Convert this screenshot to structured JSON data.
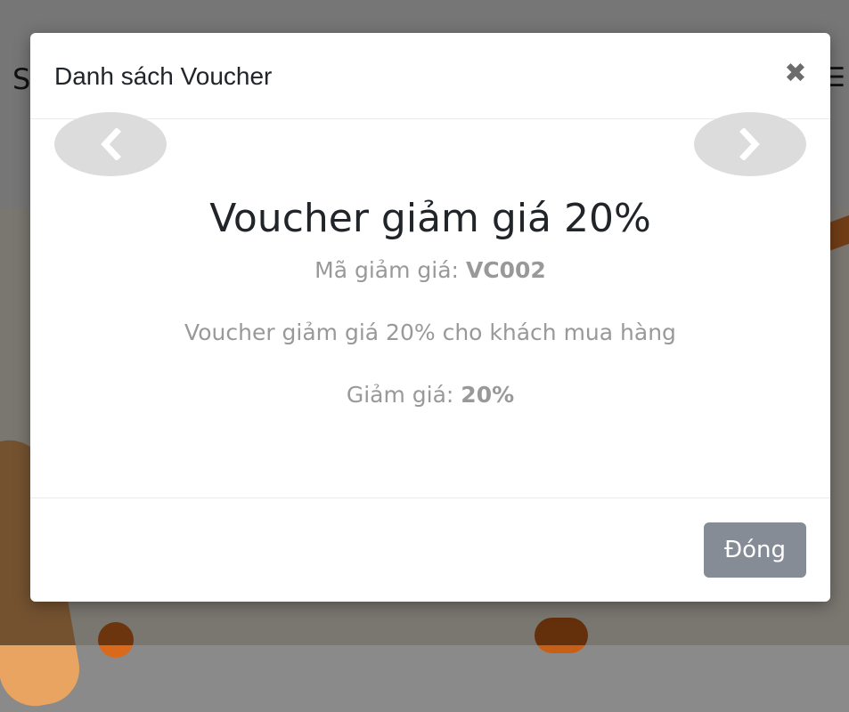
{
  "background": {
    "brand_letter": "S",
    "menu_glyph": "☰"
  },
  "modal": {
    "title": "Danh sách Voucher",
    "close_icon": "✖",
    "prev_icon": "chevron-left-icon",
    "next_icon": "chevron-right-icon",
    "voucher": {
      "title": "Voucher giảm giá 20%",
      "code_label": "Mã giảm giá: ",
      "code_value": "VC002",
      "description": "Voucher giảm giá 20% cho khách mua hàng",
      "discount_label": "Giảm giá: ",
      "discount_value": "20%"
    },
    "footer": {
      "close_label": "Đóng"
    }
  },
  "colors": {
    "overlay": "#000000",
    "text_muted": "#999999",
    "button_secondary": "#858c96",
    "carousel_control": "#dcdcdc"
  }
}
